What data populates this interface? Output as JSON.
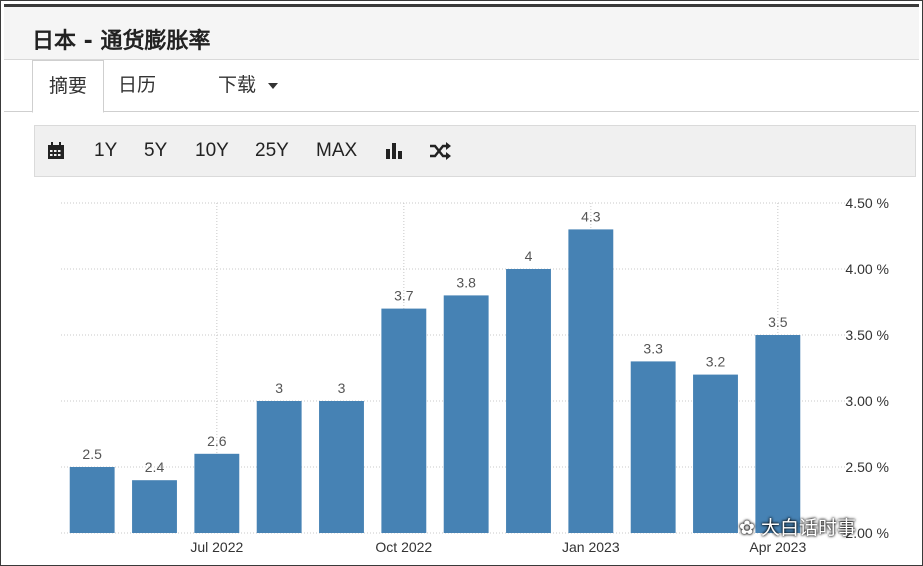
{
  "header": {
    "title": "日本 - 通货膨胀率"
  },
  "tabs": [
    {
      "label": "摘要"
    },
    {
      "label": "日历"
    },
    {
      "label": "下载"
    }
  ],
  "toolbar": {
    "ranges": [
      "1Y",
      "5Y",
      "10Y",
      "25Y",
      "MAX"
    ],
    "icons": [
      "calendar-icon",
      "bar-chart-icon",
      "shuffle-icon"
    ]
  },
  "watermark": {
    "text": "大白话时事"
  },
  "chart_data": {
    "type": "bar",
    "categories": [
      "2022-05",
      "2022-06",
      "2022-07",
      "2022-08",
      "2022-09",
      "2022-10",
      "2022-11",
      "2022-12",
      "2023-01",
      "2023-02",
      "2023-03",
      "2023-04"
    ],
    "values": [
      2.5,
      2.4,
      2.6,
      3,
      3,
      3.7,
      3.8,
      4,
      4.3,
      3.3,
      3.2,
      3.5
    ],
    "value_labels": [
      "2.5",
      "2.4",
      "2.6",
      "3",
      "3",
      "3.7",
      "3.8",
      "4",
      "4.3",
      "3.3",
      "3.2",
      "3.5"
    ],
    "x_tick_labels": [
      {
        "index": 2,
        "label": "Jul 2022"
      },
      {
        "index": 5,
        "label": "Oct 2022"
      },
      {
        "index": 8,
        "label": "Jan 2023"
      },
      {
        "index": 11,
        "label": "Apr 2023"
      }
    ],
    "y_ticks": [
      2.0,
      2.5,
      3.0,
      3.5,
      4.0,
      4.5
    ],
    "y_tick_labels": [
      "2.00 %",
      "2.50 %",
      "3.00 %",
      "3.50 %",
      "4.00 %",
      "4.50 %"
    ],
    "ylim": [
      2.0,
      4.5
    ],
    "y_axis_side": "right",
    "grid": true,
    "bar_color": "#4682b4",
    "title": "",
    "xlabel": "",
    "ylabel": ""
  }
}
